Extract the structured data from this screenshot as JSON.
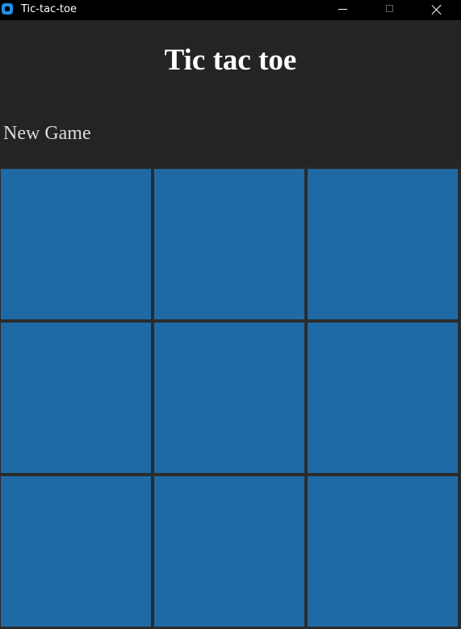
{
  "window": {
    "title": "Tic-tac-toe",
    "icon": "app-icon",
    "controls": [
      "minimize-icon",
      "maximize-icon",
      "close-icon"
    ]
  },
  "header": {
    "title": "Tic tac toe"
  },
  "controls": {
    "new_game_label": "New Game"
  },
  "board": {
    "rows": 3,
    "cols": 3,
    "cells": [
      "",
      "",
      "",
      "",
      "",
      "",
      "",
      "",
      ""
    ]
  },
  "colors": {
    "background": "#242424",
    "titlebar": "#000000",
    "cell": "#1f6aa5",
    "title_text": "#ffffff",
    "button_text": "#dcdcdc"
  }
}
